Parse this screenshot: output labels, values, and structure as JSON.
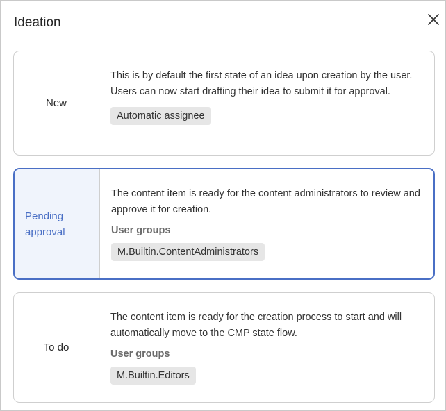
{
  "dialog": {
    "title": "Ideation"
  },
  "states": [
    {
      "label": "New",
      "description": "This is by default the first state of an idea upon creation by the user. Users can now start drafting their idea to submit it for approval.",
      "group_heading": "",
      "chip": "Automatic assignee",
      "selected": false
    },
    {
      "label": "Pending approval",
      "description": "The content item is ready for the content administrators to review and approve it for creation.",
      "group_heading": "User groups",
      "chip": "M.Builtin.ContentAdministrators",
      "selected": true
    },
    {
      "label": "To do",
      "description": "The content item is ready for the creation process to start and will automatically move to the CMP state flow.",
      "group_heading": "User groups",
      "chip": "M.Builtin.Editors",
      "selected": false
    }
  ],
  "colors": {
    "accent": "#4a6fc5",
    "selected_bg": "#f0f4fc",
    "chip_bg": "#e6e6e6",
    "border": "#cfcfcf"
  },
  "icons": {
    "close": "close-icon"
  }
}
